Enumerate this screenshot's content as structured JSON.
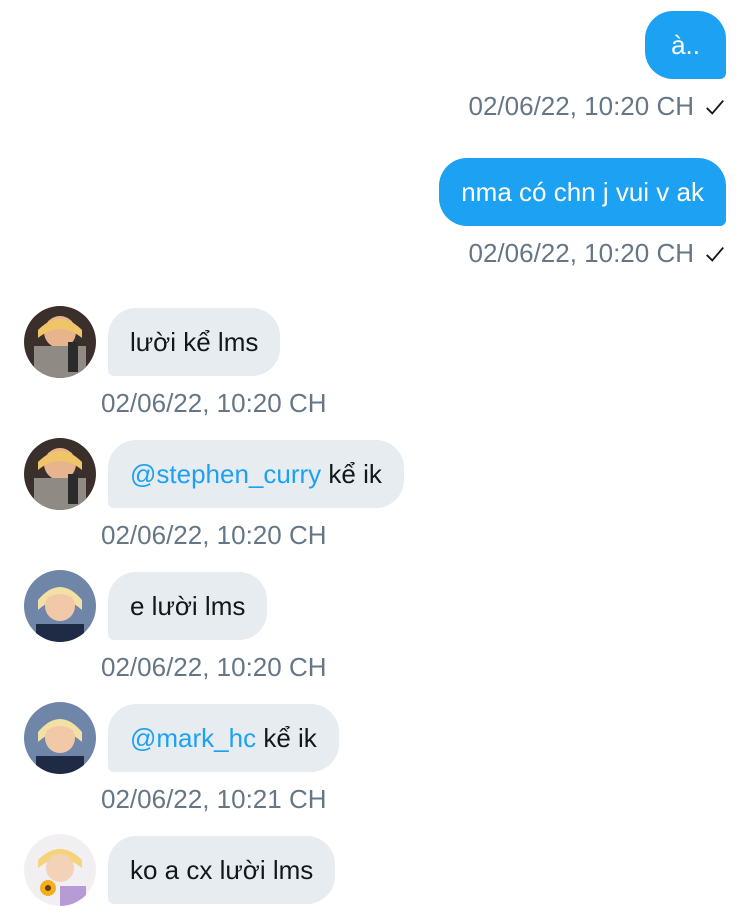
{
  "messages_out": [
    {
      "text": "à..",
      "time": "02/06/22, 10:20 CH",
      "status_icon": "check-icon"
    },
    {
      "text": "nma có chn j vui v ak",
      "time": "02/06/22, 10:20 CH",
      "status_icon": "check-icon"
    }
  ],
  "messages_in": [
    {
      "text": "lười kể lms",
      "time": "02/06/22, 10:20 CH",
      "avatar": "avatar-1"
    },
    {
      "mention": "@stephen_curry",
      "text": " kể ik",
      "time": "02/06/22, 10:20 CH",
      "avatar": "avatar-1"
    },
    {
      "text": "e lười lms",
      "time": "02/06/22, 10:20 CH",
      "avatar": "avatar-2"
    },
    {
      "mention": "@mark_hc",
      "text": " kể ik",
      "time": "02/06/22, 10:21 CH",
      "avatar": "avatar-2"
    },
    {
      "text": "ko a cx lười lms",
      "avatar": "avatar-3"
    }
  ],
  "colors": {
    "bubble_out": "#1da1f2",
    "bubble_in": "#e6ecf0",
    "timestamp": "#657786",
    "mention": "#1da1f2"
  }
}
